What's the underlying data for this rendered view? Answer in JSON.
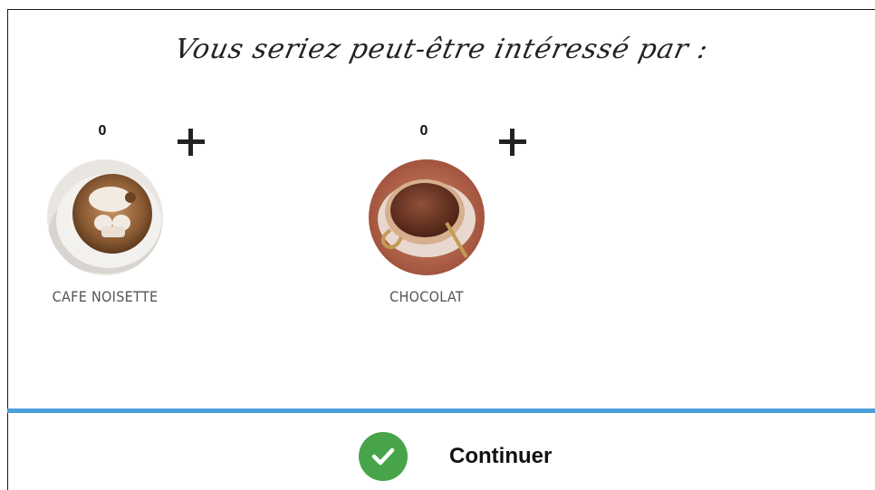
{
  "header": {
    "title": "Vous seriez peut-être intéressé par :"
  },
  "products": [
    {
      "name": "CAFE NOISETTE",
      "quantity": "0",
      "icon": "plus-icon"
    },
    {
      "name": "CHOCOLAT",
      "quantity": "0",
      "icon": "plus-icon"
    }
  ],
  "footer": {
    "continue_label": "Continuer",
    "continue_icon": "checkmark-icon",
    "divider_color": "#4a9fd8",
    "check_color": "#47a44a"
  }
}
